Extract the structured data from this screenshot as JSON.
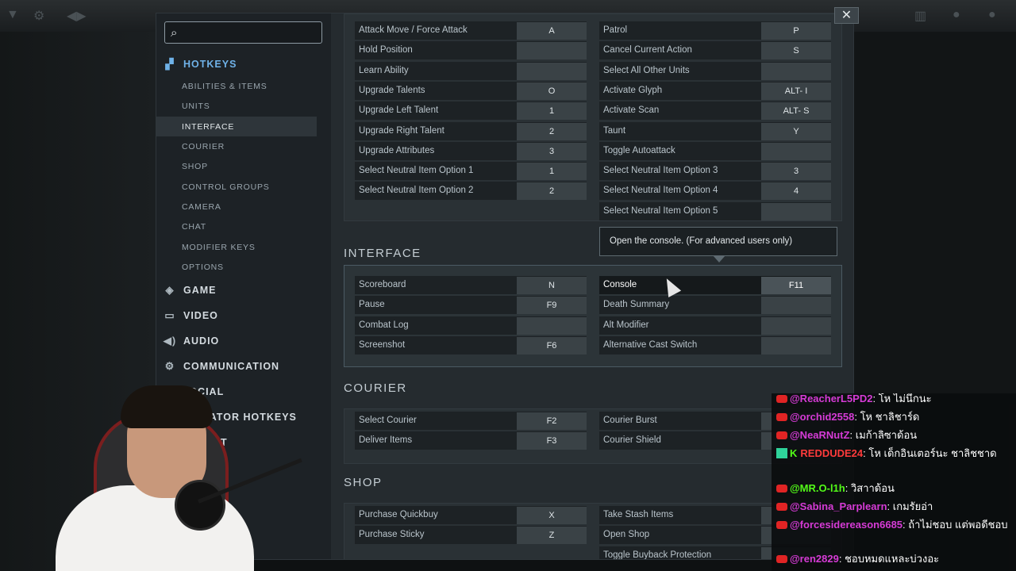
{
  "sidebar": {
    "search_placeholder": "",
    "hotkeys_label": "HOTKEYS",
    "sub_items": [
      "ABILITIES & ITEMS",
      "UNITS",
      "INTERFACE",
      "COURIER",
      "SHOP",
      "CONTROL GROUPS",
      "CAMERA",
      "CHAT",
      "MODIFIER KEYS",
      "OPTIONS"
    ],
    "main_items": [
      {
        "label": "GAME",
        "icon": "gamepad-icon"
      },
      {
        "label": "VIDEO",
        "icon": "monitor-icon"
      },
      {
        "label": "AUDIO",
        "icon": "speaker-icon"
      },
      {
        "label": "COMMUNICATION",
        "icon": "gear-icon"
      },
      {
        "label": "SOCIAL",
        "icon": "people-icon"
      }
    ],
    "partial_items": [
      "TATOR HOTKEYS",
      "NT"
    ]
  },
  "close_label": "✕",
  "top_rows": {
    "left": [
      {
        "label": "Attack Move / Force Attack",
        "key": "A"
      },
      {
        "label": "Hold Position",
        "key": ""
      },
      {
        "label": "Learn Ability",
        "key": ""
      },
      {
        "label": "Upgrade Talents",
        "key": "O"
      },
      {
        "label": "Upgrade Left Talent",
        "key": "1"
      },
      {
        "label": "Upgrade Right Talent",
        "key": "2"
      },
      {
        "label": "Upgrade Attributes",
        "key": "3"
      },
      {
        "label": "Select Neutral Item Option 1",
        "key": "1"
      },
      {
        "label": "Select Neutral Item Option 2",
        "key": "2"
      }
    ],
    "right": [
      {
        "label": "Patrol",
        "key": "P"
      },
      {
        "label": "Cancel Current Action",
        "key": "S"
      },
      {
        "label": "Select All Other Units",
        "key": ""
      },
      {
        "label": "Activate Glyph",
        "key": "ALT- I"
      },
      {
        "label": "Activate Scan",
        "key": "ALT- S"
      },
      {
        "label": "Taunt",
        "key": "Y"
      },
      {
        "label": "Toggle Autoattack",
        "key": ""
      },
      {
        "label": "Select Neutral Item Option 3",
        "key": "3"
      },
      {
        "label": "Select Neutral Item Option 4",
        "key": "4"
      },
      {
        "label": "Select Neutral Item Option 5",
        "key": ""
      }
    ]
  },
  "interface": {
    "title": "INTERFACE",
    "left": [
      {
        "label": "Scoreboard",
        "key": "N"
      },
      {
        "label": "Pause",
        "key": "F9"
      },
      {
        "label": "Combat Log",
        "key": ""
      },
      {
        "label": "Screenshot",
        "key": "F6"
      }
    ],
    "right": [
      {
        "label": "Console",
        "key": "F11"
      },
      {
        "label": "Death Summary",
        "key": ""
      },
      {
        "label": "Alt Modifier",
        "key": ""
      },
      {
        "label": "Alternative Cast Switch",
        "key": ""
      }
    ]
  },
  "tooltip": "Open the console. (For advanced users only)",
  "courier": {
    "title": "COURIER",
    "left": [
      {
        "label": "Select Courier",
        "key": "F2"
      },
      {
        "label": "Deliver Items",
        "key": "F3"
      }
    ],
    "right": [
      {
        "label": "Courier Burst",
        "key": ""
      },
      {
        "label": "Courier Shield",
        "key": ""
      }
    ]
  },
  "shop": {
    "title": "SHOP",
    "left": [
      {
        "label": "Purchase Quickbuy",
        "key": "X"
      },
      {
        "label": "Purchase Sticky",
        "key": "Z"
      }
    ],
    "right": [
      {
        "label": "Take Stash Items",
        "key": ""
      },
      {
        "label": "Open Shop",
        "key": ""
      },
      {
        "label": "Toggle Buyback Protection",
        "key": ""
      }
    ]
  },
  "chat": [
    {
      "platform": "youtube",
      "user": "@ReacherL5PD2",
      "text": "โห ไม่นึกนะ",
      "color": "#d63bd6"
    },
    {
      "platform": "youtube",
      "user": "@orchid2558",
      "text": "โห ชาลิชาร์ด",
      "color": "#d63bd6"
    },
    {
      "platform": "youtube",
      "user": "@NeaRNutZ",
      "text": "เมก้าลิซาด้อน",
      "color": "#d63bd6"
    },
    {
      "platform": "kick",
      "user": "REDDUDE24",
      "text": "โห เด็กอินเตอร์นะ ชาลิชชาด",
      "color": "#ff3b3b"
    },
    {
      "platform": "youtube",
      "user": "@MR.O-l1h",
      "text": "วิสาาด้อน",
      "color": "#53fc18"
    },
    {
      "platform": "youtube",
      "user": "@Sabina_Parplearn",
      "text": "เกมรัยอ่า",
      "color": "#d63bd6"
    },
    {
      "platform": "youtube",
      "user": "@forcesidereason6685",
      "text": "ถ้าไม่ชอบ แต่พอดีชอบ",
      "color": "#d63bd6"
    },
    {
      "platform": "youtube",
      "user": "@ren2829",
      "text": "ชอบหมดแหละบ่วงอะ",
      "color": "#d63bd6"
    }
  ]
}
